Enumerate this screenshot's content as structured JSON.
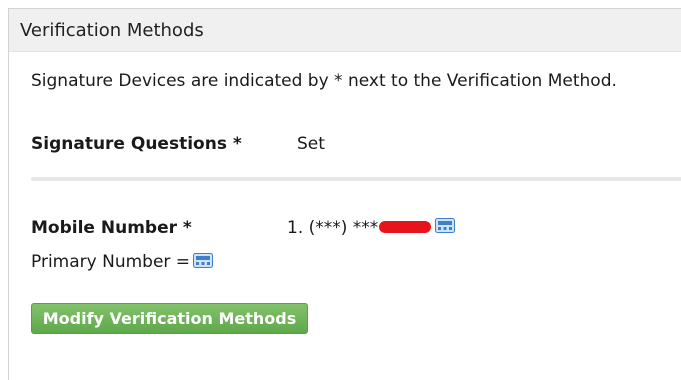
{
  "panel": {
    "title": "Verification Methods"
  },
  "intro_text": "Signature Devices are indicated by * next to the Verification Method.",
  "signature_questions": {
    "label": "Signature Questions *",
    "value": "Set"
  },
  "mobile_number": {
    "label": "Mobile Number *",
    "value": "1. (***) ***",
    "icon": "phone-icon"
  },
  "primary_number": {
    "label": "Primary Number =",
    "icon": "phone-icon"
  },
  "actions": {
    "modify_label": "Modify Verification Methods"
  },
  "colors": {
    "button_green": "#6bb356",
    "redaction": "#e8141b",
    "icon_blue": "#4a90d9"
  }
}
